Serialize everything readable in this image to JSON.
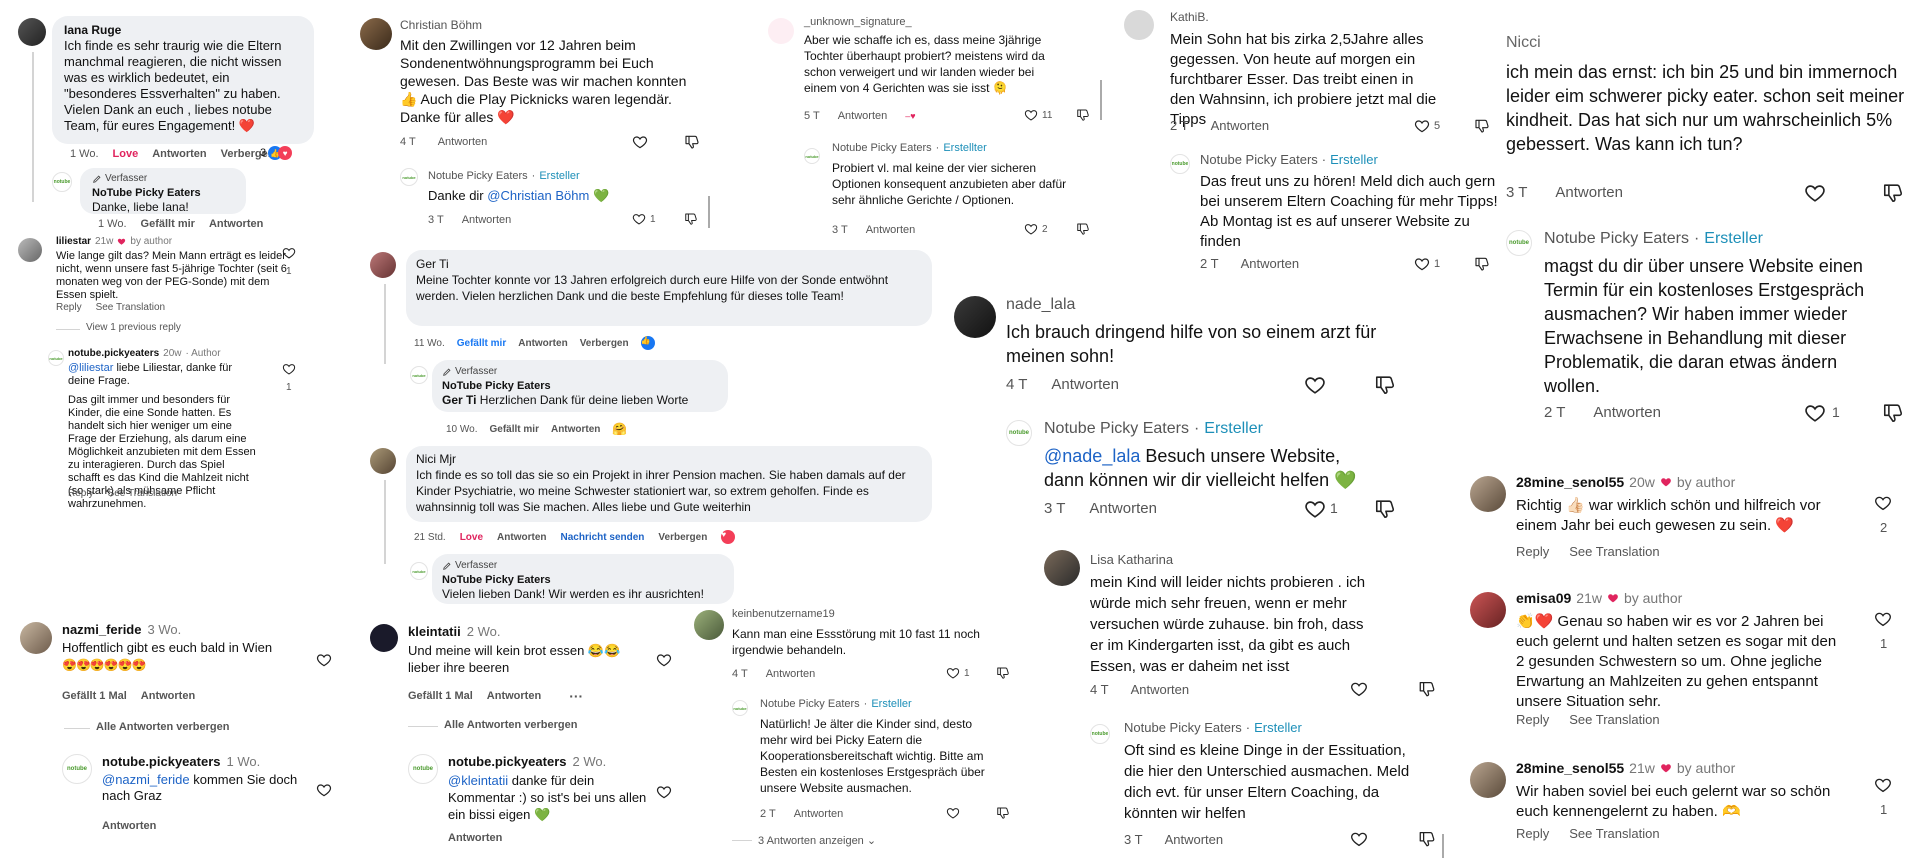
{
  "c1": {
    "name": "Iana Ruge",
    "text": "Ich finde es sehr traurig wie die Eltern manchmal reagieren, die nicht wissen was es wirklich bedeutet, ein \"besonderes Essverhalten\" zu haben. Vielen Dank an euch , liebes notube Team, für eures Engagement! ❤️",
    "time": "1 Wo.",
    "love": "Love",
    "reply": "Antworten",
    "hide": "Verbergen",
    "count": "3",
    "r_author_tag": "Verfasser",
    "r_name": "NoTube Picky Eaters",
    "r_text": "Danke, liebe Iana!",
    "r_time": "1 Wo.",
    "r_like": "Gefällt mir",
    "r_reply": "Antworten"
  },
  "c2": {
    "name": "liliestar",
    "time": "21w",
    "by_author": "by author",
    "text": "Wie lange gilt das? Mein Mann erträgt es leider nicht, wenn unsere fast 5-jährige Tochter (seit 6 monaten weg von der PEG-Sonde) mit dem Essen spielt.",
    "reply": "Reply",
    "translate": "See Translation",
    "likes": "1",
    "view_prev": "View 1 previous reply"
  },
  "c3": {
    "name": "notube.pickyeaters",
    "time": "20w",
    "author": "· Author",
    "mention": "@liliestar",
    "text1": " liebe Liliestar, danke für deine Frage.",
    "text2": "Das gilt immer und besonders für Kinder, die eine Sonde hatten. Es handelt sich hier weniger um eine Frage der Erziehung, als darum eine Möglichkeit anzubieten mit dem Essen zu interagieren. Durch das Spiel schafft es das Kind die Mahlzeit nicht (so stark) als mühsame Pflicht wahrzunehmen.",
    "reply": "Reply",
    "translate": "See Translation",
    "likes": "1"
  },
  "c4": {
    "name": "nazmi_feride",
    "time": "3 Wo.",
    "text": "Hoffentlich gibt es euch bald in Wien",
    "emojis": "😍😍😍😍😍😍",
    "likes": "Gefällt 1 Mal",
    "reply": "Antworten",
    "hide_all": "Alle Antworten verbergen",
    "r_name": "notube.pickyeaters",
    "r_time": "1 Wo.",
    "r_mention": "@nazmi_feride",
    "r_text": " kommen Sie doch nach Graz",
    "r_reply": "Antworten"
  },
  "c5": {
    "name": "Christian Böhm",
    "text": "Mit den Zwillingen vor 12 Jahren beim Sondenentwöhnungsprogramm bei Euch gewesen. Das Beste was wir machen konnten 👍 Auch die Play Picknicks waren legendär. Danke für alles ❤️",
    "time": "4 T",
    "reply": "Antworten",
    "r_name": "Notube Picky Eaters",
    "r_creator": "Ersteller",
    "r_text1": "Danke dir ",
    "r_mention": "@Christian Böhm",
    "r_text2": " 💚",
    "r_time": "3 T",
    "r_reply": "Antworten",
    "r_likes": "1"
  },
  "c6": {
    "name": "Ger Ti",
    "text": "Meine Tochter konnte vor 13 Jahren erfolgreich durch eure Hilfe von der Sonde entwöhnt werden. Vielen herzlichen Dank und die beste Empfehlung für dieses tolle Team!",
    "time": "11 Wo.",
    "like": "Gefällt mir",
    "reply": "Antworten",
    "hide": "Verbergen",
    "r_author_tag": "Verfasser",
    "r_name": "NoTube Picky Eaters",
    "r_bold": "Ger Ti",
    "r_text": " Herzlichen Dank für deine lieben Worte",
    "r_time": "10 Wo.",
    "r_like": "Gefällt mir",
    "r_reply": "Antworten"
  },
  "c7": {
    "name": "Nici Mjr",
    "text": "Ich finde es so toll das sie so ein Projekt in ihrer Pension machen. Sie haben damals auf der Kinder Psychiatrie, wo meine Schwester stationiert war, so extrem geholfen. Finde es wahnsinnig toll was Sie machen. Alles liebe und Gute weiterhin",
    "time": "21 Std.",
    "love": "Love",
    "reply": "Antworten",
    "message": "Nachricht senden",
    "hide": "Verbergen",
    "r_author_tag": "Verfasser",
    "r_name": "NoTube Picky Eaters",
    "r_text": "Vielen lieben Dank! Wir werden es ihr ausrichten!"
  },
  "c8": {
    "name": "kleintatii",
    "time": "2 Wo.",
    "text": "Und meine will kein brot essen 😂😂 lieber ihre beeren",
    "likes": "Gefällt 1 Mal",
    "reply": "Antworten",
    "more": "···",
    "hide_all": "Alle Antworten verbergen",
    "r_name": "notube.pickyeaters",
    "r_time": "2 Wo.",
    "r_mention": "@kleintatii",
    "r_text": " danke für dein Kommentar :) so ist's bei uns allen ein bissi eigen 💚",
    "r_reply": "Antworten"
  },
  "c9": {
    "name": "_unknown_signature_",
    "text": "Aber wie schaffe ich es, dass meine 3jährige Tochter überhaupt probiert? meistens wird da schon verweigert und wir landen wieder bei einem von 4 Gerichten was sie isst 🫠",
    "time": "5 T",
    "reply": "Antworten",
    "likes": "11",
    "r_name": "Notube Picky Eaters",
    "r_creator": "Erstellter",
    "r_text": "Probiert vl. mal keine der vier sicheren Optionen konsequent anzubieten aber dafür sehr ähnliche Gerichte / Optionen.",
    "r_time": "3 T",
    "r_reply": "Antworten",
    "r_likes": "2"
  },
  "c10": {
    "name": "keinbenutzername19",
    "text": "Kann man eine Essstörung mit 10 fast 11 noch irgendwie behandeln.",
    "time": "4 T",
    "reply": "Antworten",
    "likes": "1",
    "r_name": "Notube Picky Eaters",
    "r_creator": "Ersteller",
    "r_text": "Natürlich! Je älter die Kinder sind, desto mehr wird bei Picky Eatern die Kooperationsbereitschaft wichtig. Bitte am Besten ein kostenloses Erstgespräch über unsere Website ausmachen.",
    "r_time": "2 T",
    "r_reply": "Antworten",
    "show_replies": "3 Antworten anzeigen"
  },
  "c11": {
    "name": "KathiB.",
    "text": "Mein Sohn hat bis zirka 2,5Jahre alles gegessen. Von heute auf morgen ein furchtbarer Esser. Das treibt einen in den Wahnsinn, ich probiere jetzt mal die Tipps",
    "time": "2 T",
    "reply": "Antworten",
    "likes": "5",
    "r_name": "Notube Picky Eaters",
    "r_creator": "Ersteller",
    "r_text": "Das freut uns zu hören! Meld dich auch gern bei unserem Eltern Coaching für mehr Tipps! Ab Montag ist es auf unserer Website zu finden",
    "r_time": "2 T",
    "r_reply": "Antworten",
    "r_likes": "1"
  },
  "c12": {
    "name": "nade_lala",
    "text": "Ich brauch dringend hilfe von so einem arzt für meinen sohn!",
    "time": "4 T",
    "reply": "Antworten",
    "r_name": "Notube Picky Eaters",
    "r_creator": "Ersteller",
    "r_mention": "@nade_lala",
    "r_text": " Besuch unsere Website, dann können wir dir vielleicht helfen 💚",
    "r_time": "3 T",
    "r_reply": "Antworten",
    "r_likes": "1"
  },
  "c13": {
    "name": "Lisa Katharina",
    "text": "mein Kind will leider nichts probieren . ich würde mich sehr freuen, wenn er mehr versuchen würde zuhause. bin froh, dass er im Kindergarten isst, da gibt es auch Essen, was er daheim net isst",
    "time": "4 T",
    "reply": "Antworten",
    "r_name": "Notube Picky Eaters",
    "r_creator": "Ersteller",
    "r_text": "Oft sind es kleine Dinge in der Essituation, die hier den Unterschied ausmachen. Meld dich evt. für unser Eltern Coaching, da könnten wir helfen",
    "r_time": "3 T",
    "r_reply": "Antworten"
  },
  "c14": {
    "name": "Nicci",
    "text": "ich mein das ernst: ich bin 25 und bin immernoch leider eim schwerer picky eater. schon seit meiner kindheit. Das hat sich nur um wahrscheinlich 5% gebessert. Was kann ich tun?",
    "time": "3 T",
    "reply": "Antworten",
    "r_name": "Notube Picky Eaters",
    "r_creator": "Ersteller",
    "r_text": "magst du dir über unsere Website einen Termin für ein kostenloses Erstgespräch ausmachen? Wir haben immer wieder Erwachsene in Behandlung mit dieser Problematik, die daran etwas ändern wollen.",
    "r_time": "2 T",
    "r_reply": "Antworten",
    "r_likes": "1"
  },
  "c15": {
    "name": "28mine_senol55",
    "time": "20w",
    "by_author": "by author",
    "text": "Richtig 👍🏻 war wirklich schön und hilfreich vor einem Jahr bei euch gewesen zu sein. ❤️",
    "reply": "Reply",
    "translate": "See Translation",
    "likes": "2"
  },
  "c16": {
    "name": "emisa09",
    "time": "21w",
    "by_author": "by author",
    "text": "👏❤️ Genau so haben wir es vor 2 Jahren bei euch gelernt und halten setzen es sogar mit den 2 gesunden Schwestern so um. Ohne jegliche Erwartung an Mahlzeiten zu gehen entspannt unsere Situation sehr.",
    "reply": "Reply",
    "translate": "See Translation",
    "likes": "1"
  },
  "c17": {
    "name": "28mine_senol55",
    "time": "21w",
    "by_author": "by author",
    "text": "Wir haben soviel bei euch gelernt war so schön euch kennengelernt zu haben. 🫶",
    "reply": "Reply",
    "translate": "See Translation",
    "likes": "1"
  },
  "brand": {
    "logo_text": "notube",
    "green": "#4a9a2d",
    "creator_color": "#1d8fb8",
    "bubble": "#eef0f3",
    "love_red": "#e0245e"
  }
}
